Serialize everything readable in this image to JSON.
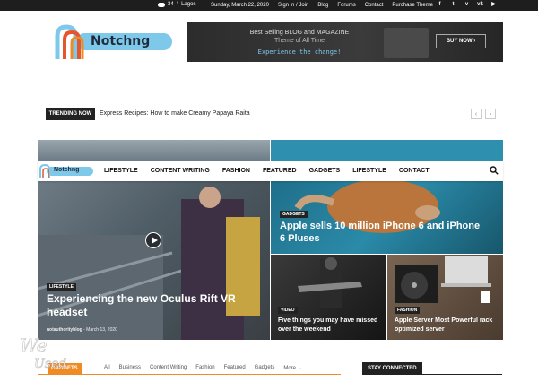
{
  "topbar": {
    "temperature": "34",
    "temp_unit": "°",
    "city": "Lagos",
    "date": "Sunday, March 22, 2020",
    "links": [
      "Sign in / Join",
      "Blog",
      "Forums",
      "Contact",
      "Purchase Theme"
    ],
    "social": [
      "facebook-icon",
      "twitter-icon",
      "vimeo-icon",
      "vk-icon",
      "youtube-icon"
    ]
  },
  "logo": {
    "text": "Notchng"
  },
  "banner": {
    "line1": "Best Selling BLOG and MAGAZINE",
    "line2": "Theme of All Time",
    "line3": "Experience the change!",
    "cta": "BUY NOW ›"
  },
  "trending": {
    "tag": "TRENDING NOW",
    "headline": "Express Recipes: How to make Creamy Papaya Raita",
    "prev": "‹",
    "next": "›"
  },
  "nav": {
    "logo_text": "Notchng",
    "items": [
      "LIFESTYLE",
      "CONTENT WRITING",
      "FASHION",
      "FEATURED",
      "GADGETS",
      "LIFESTYLE",
      "CONTACT"
    ]
  },
  "tiles": [
    {
      "category": "LIFESTYLE",
      "title": "Experiencing the new Oculus Rift VR headset",
      "author": "notauthorityblog",
      "date": "March 13, 2020"
    },
    {
      "category": "GADGETS",
      "title": "Apple sells 10 million iPhone 6 and iPhone 6 Pluses"
    },
    {
      "category": "VIDEO",
      "title": "Five things you may have missed over the weekend"
    },
    {
      "category": "FASHION",
      "title": "Apple Server Most Powerful rack optimized server"
    }
  ],
  "section": {
    "label": "GADGETS",
    "filters": [
      "All",
      "Business",
      "Content Writing",
      "Fashion",
      "Featured",
      "Gadgets",
      "More"
    ]
  },
  "sidebar": {
    "stay_connected": "STAY CONNECTED"
  },
  "colors": {
    "accent": "#f08a24",
    "logo_blue": "#7ec8ea",
    "dark": "#222222"
  }
}
